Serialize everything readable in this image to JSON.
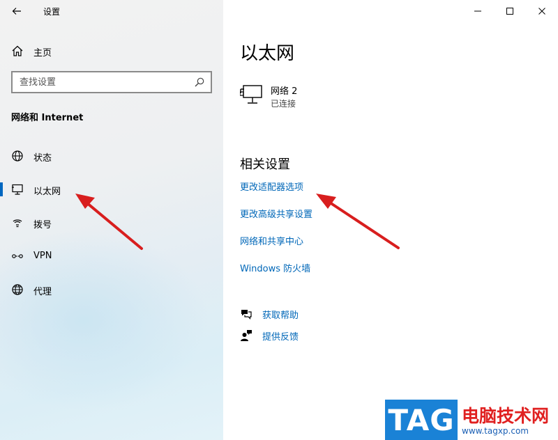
{
  "window": {
    "title": "设置",
    "controls": {
      "minimize": "minimize",
      "maximize": "maximize",
      "close": "close"
    }
  },
  "sidebar": {
    "home_label": "主页",
    "search_placeholder": "查找设置",
    "section_title": "网络和 Internet",
    "items": [
      {
        "label": "状态",
        "icon": "globe-status-icon"
      },
      {
        "label": "以太网",
        "icon": "ethernet-icon",
        "selected": true
      },
      {
        "label": "拨号",
        "icon": "dialup-icon"
      },
      {
        "label": "VPN",
        "icon": "vpn-icon"
      },
      {
        "label": "代理",
        "icon": "proxy-globe-icon"
      }
    ]
  },
  "main": {
    "title": "以太网",
    "network": {
      "name": "网络 2",
      "status": "已连接"
    },
    "related_title": "相关设置",
    "related_links": [
      "更改适配器选项",
      "更改高级共享设置",
      "网络和共享中心",
      "Windows 防火墙"
    ],
    "help": [
      {
        "label": "获取帮助",
        "icon": "help-chat-icon"
      },
      {
        "label": "提供反馈",
        "icon": "feedback-icon"
      }
    ]
  },
  "watermark": {
    "logo": "TAG",
    "name": "电脑技术网",
    "url": "www.tagxp.com"
  },
  "colors": {
    "accent": "#0067c0",
    "link": "#0067b8",
    "annotation_arrow": "#d81e1e"
  }
}
